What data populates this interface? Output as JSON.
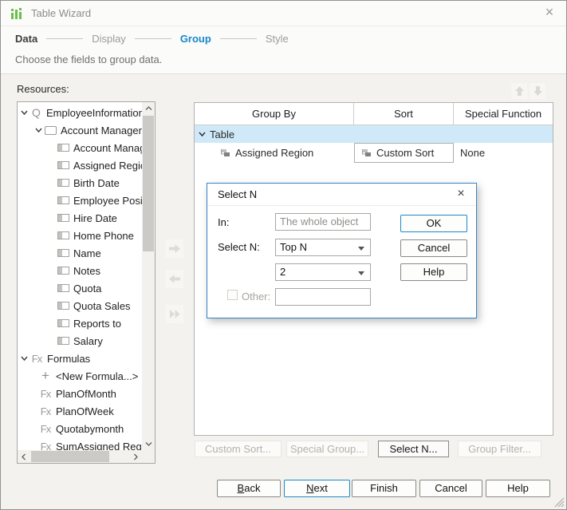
{
  "window": {
    "title": "Table Wizard"
  },
  "icons": {
    "close": "×",
    "query": "Q",
    "formula": "Fx",
    "plus": "+"
  },
  "colors": {
    "accent_blue": "#1688c9",
    "dialog_border_blue": "#3584c4",
    "selected_row_blue": "#cfe9f8",
    "logo_green": "#6abf4a",
    "disabled_text": "#b3b2ae"
  },
  "steps": [
    {
      "label": "Data",
      "state": "done"
    },
    {
      "label": "Display",
      "state": "default"
    },
    {
      "label": "Group",
      "state": "active"
    },
    {
      "label": "Style",
      "state": "default"
    }
  ],
  "subtitle": "Choose the fields to group data.",
  "resources": {
    "label": "Resources:",
    "items": [
      {
        "label": "EmployeeInformation",
        "icon": "query",
        "expanded": true
      },
      {
        "label": "Account Managers",
        "icon": "table",
        "expanded": true
      },
      {
        "label": "Account Managers I",
        "icon": "field"
      },
      {
        "label": "Assigned Region",
        "icon": "field"
      },
      {
        "label": "Birth Date",
        "icon": "field"
      },
      {
        "label": "Employee Position",
        "icon": "field"
      },
      {
        "label": "Hire Date",
        "icon": "field"
      },
      {
        "label": "Home Phone",
        "icon": "field"
      },
      {
        "label": "Name",
        "icon": "field"
      },
      {
        "label": "Notes",
        "icon": "field"
      },
      {
        "label": "Quota",
        "icon": "field"
      },
      {
        "label": "Quota Sales",
        "icon": "field"
      },
      {
        "label": "Reports to",
        "icon": "field"
      },
      {
        "label": "Salary",
        "icon": "field"
      },
      {
        "label": "Formulas",
        "icon": "formula",
        "expanded": true
      },
      {
        "label": "<New Formula...>",
        "icon": "plus"
      },
      {
        "label": "PlanOfMonth",
        "icon": "formula"
      },
      {
        "label": "PlanOfWeek",
        "icon": "formula"
      },
      {
        "label": "Quotabymonth",
        "icon": "formula"
      },
      {
        "label": "SumAssigned Region",
        "icon": "formula"
      }
    ]
  },
  "group_table": {
    "columns": [
      "Group By",
      "Sort",
      "Special Function"
    ],
    "rows": [
      {
        "group_by": "Table",
        "selected": true
      },
      {
        "group_by": "Assigned Region",
        "sort": "Custom Sort",
        "special_function": "None"
      }
    ]
  },
  "select_n_dialog": {
    "title": "Select N",
    "in_label": "In:",
    "in_value": "The whole object",
    "select_n_label": "Select N:",
    "select_n_value": "Top N",
    "n_value": "2",
    "other_label": "Other:",
    "other_value": "",
    "buttons": {
      "ok": "OK",
      "cancel": "Cancel",
      "help": "Help"
    }
  },
  "action_buttons": {
    "custom_sort": {
      "label": "Custom Sort...",
      "enabled": false
    },
    "special_group": {
      "label": "Special Group...",
      "enabled": false
    },
    "select_n": {
      "label": "Select N...",
      "enabled": true
    },
    "group_filter": {
      "label": "Group Filter...",
      "enabled": false
    }
  },
  "wizard_buttons": {
    "back": {
      "accel": "B",
      "rest": "ack"
    },
    "next": {
      "accel": "N",
      "rest": "ext"
    },
    "finish": "Finish",
    "cancel": "Cancel",
    "help": "Help"
  }
}
